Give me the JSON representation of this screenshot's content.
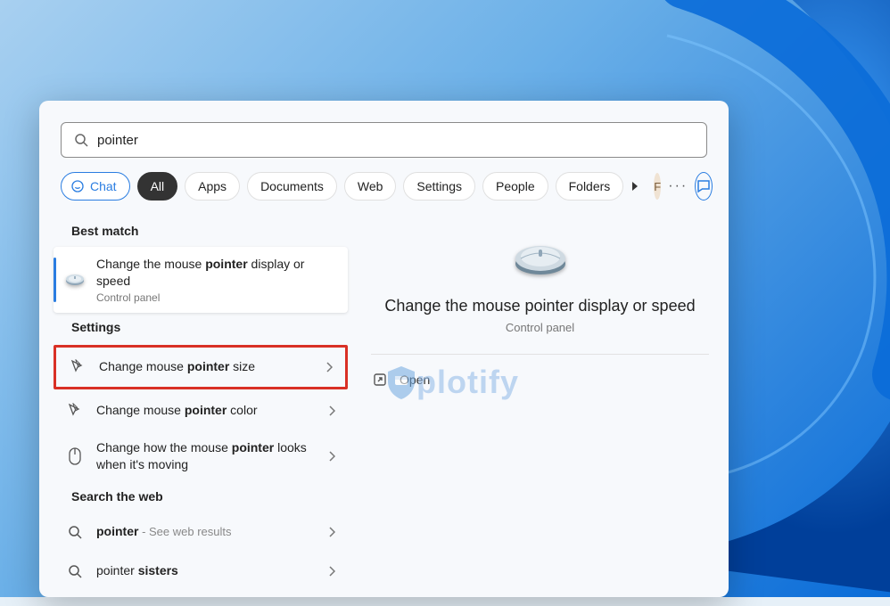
{
  "search": {
    "query": "pointer"
  },
  "filters": {
    "chat": "Chat",
    "tabs": [
      "All",
      "Apps",
      "Documents",
      "Web",
      "Settings",
      "People",
      "Folders"
    ],
    "active_index": 0,
    "user_initial": "F"
  },
  "sections": {
    "best_match": {
      "header": "Best match",
      "item": {
        "title_pre": "Change the mouse ",
        "title_bold": "pointer",
        "title_post": " display or speed",
        "sub": "Control panel"
      }
    },
    "settings": {
      "header": "Settings",
      "items": [
        {
          "pre": "Change mouse ",
          "bold": "pointer",
          "post": " size"
        },
        {
          "pre": "Change mouse ",
          "bold": "pointer",
          "post": " color"
        },
        {
          "pre": "Change how the mouse ",
          "bold": "pointer",
          "post": " looks when it's moving"
        }
      ]
    },
    "web": {
      "header": "Search the web",
      "items": [
        {
          "pre": "",
          "bold": "pointer",
          "post": "",
          "suffix": " - See web results"
        },
        {
          "pre": "pointer ",
          "bold": "sisters",
          "post": "",
          "suffix": ""
        }
      ]
    }
  },
  "preview": {
    "title": "Change the mouse pointer display or speed",
    "sub": "Control panel",
    "open": "Open"
  },
  "watermark": "plotify"
}
